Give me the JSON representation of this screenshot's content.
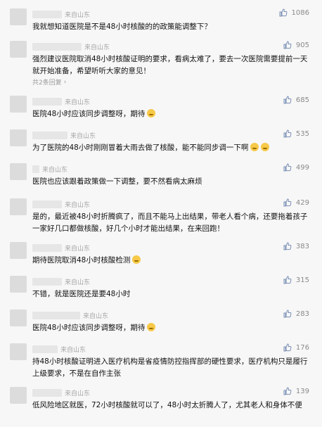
{
  "location_label": "来自山东",
  "comments": [
    {
      "likes": "1086",
      "text": "我就想知道医院是不是48小时核酸的的政策能调整下？"
    },
    {
      "likes": "905",
      "text": "强烈建议医院取消48小时核酸证明的要求，看病太难了，要去一次医院需要提前一天就开始准备，希望听听大家的意见！",
      "replies": "共2条回复"
    },
    {
      "likes": "685",
      "text": "医院48小时应该同步调整呀，期待"
    },
    {
      "likes": "535",
      "text": "为了医院的48小时刚刚冒着大雨去做了核酸，能不能同步调一下啊"
    },
    {
      "likes": "499",
      "text": "医院也应该跟着政策做一下调整，要不然看病太麻烦"
    },
    {
      "likes": "429",
      "text": "是的，最近被48小时折腾疯了，而且不能马上出结果，带老人看个病，还要拖着孩子一家好几口都做核酸，好几个小时才能出结果，在来回跑！"
    },
    {
      "likes": "383",
      "text": "期待医院取消48小时核酸检测"
    },
    {
      "likes": "315",
      "text": "不错，就是医院还是要48小时"
    },
    {
      "likes": "283",
      "text": "医院48小时应该同步调整呀，期待"
    },
    {
      "likes": "176",
      "text": "持48小时核酸证明进入医疗机构是省疫情防控指挥部的硬性要求，医疗机构只是履行上级要求，不是在自作主张"
    },
    {
      "likes": "139",
      "text": "低风险地区就医，72小时核酸就可以了，48小时太折腾人了，尤其老人和身体不便"
    }
  ]
}
